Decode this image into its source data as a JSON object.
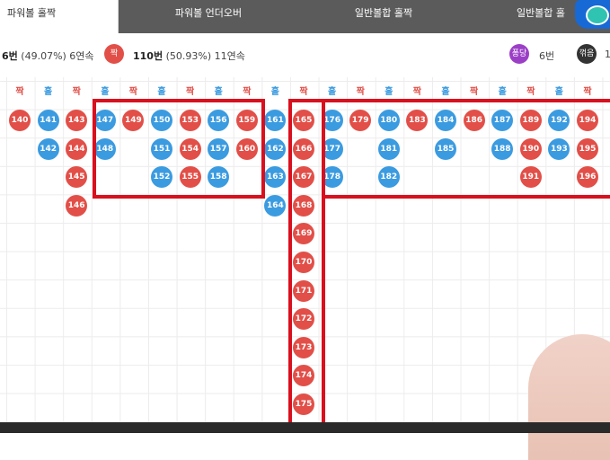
{
  "tabs": [
    {
      "label": "파워볼 홀짝",
      "active": true
    },
    {
      "label": "파워볼 언더오버",
      "active": false
    },
    {
      "label": "일반볼합 홀짝",
      "active": false
    },
    {
      "label": "일반볼합 홀",
      "active": false
    }
  ],
  "stats": {
    "left_prefix": "6번",
    "left_pct": "(49.07%) 6연속",
    "badge_red": "짝",
    "right_count": "110번",
    "right_pct": "(50.93%) 11연속",
    "badge_purple": "퐁당",
    "purple_count": "6번",
    "badge_dark": "꺾음",
    "dark_count": "1"
  },
  "colors": {
    "red": "#e24f48",
    "blue": "#3b9be0",
    "highlight": "#d9101e",
    "purple": "#9c3fc7"
  },
  "columns": [
    {
      "header": "짝",
      "color": "red",
      "balls": [
        "140"
      ]
    },
    {
      "header": "홀",
      "color": "blue",
      "balls": [
        "141",
        "142"
      ]
    },
    {
      "header": "짝",
      "color": "red",
      "balls": [
        "143",
        "144",
        "145",
        "146"
      ]
    },
    {
      "header": "홀",
      "color": "blue",
      "balls": [
        "147",
        "148"
      ]
    },
    {
      "header": "짝",
      "color": "red",
      "balls": [
        "149"
      ]
    },
    {
      "header": "홀",
      "color": "blue",
      "balls": [
        "150",
        "151",
        "152"
      ]
    },
    {
      "header": "짝",
      "color": "red",
      "balls": [
        "153",
        "154",
        "155"
      ]
    },
    {
      "header": "홀",
      "color": "blue",
      "balls": [
        "156",
        "157",
        "158"
      ]
    },
    {
      "header": "짝",
      "color": "red",
      "balls": [
        "159",
        "160"
      ]
    },
    {
      "header": "홀",
      "color": "blue",
      "balls": [
        "161",
        "162",
        "163",
        "164"
      ]
    },
    {
      "header": "짝",
      "color": "red",
      "balls": [
        "165",
        "166",
        "167",
        "168",
        "169",
        "170",
        "171",
        "172",
        "173",
        "174",
        "175"
      ]
    },
    {
      "header": "홀",
      "color": "blue",
      "balls": [
        "176",
        "177",
        "178"
      ]
    },
    {
      "header": "짝",
      "color": "red",
      "balls": [
        "179"
      ]
    },
    {
      "header": "홀",
      "color": "blue",
      "balls": [
        "180",
        "181",
        "182"
      ]
    },
    {
      "header": "짝",
      "color": "red",
      "balls": [
        "183"
      ]
    },
    {
      "header": "홀",
      "color": "blue",
      "balls": [
        "184",
        "185"
      ]
    },
    {
      "header": "짝",
      "color": "red",
      "balls": [
        "186"
      ]
    },
    {
      "header": "홀",
      "color": "blue",
      "balls": [
        "187",
        "188"
      ]
    },
    {
      "header": "짝",
      "color": "red",
      "balls": [
        "189",
        "190",
        "191"
      ]
    },
    {
      "header": "홀",
      "color": "blue",
      "balls": [
        "192",
        "193"
      ]
    },
    {
      "header": "짝",
      "color": "red",
      "balls": [
        "194",
        "195",
        "196"
      ]
    }
  ]
}
